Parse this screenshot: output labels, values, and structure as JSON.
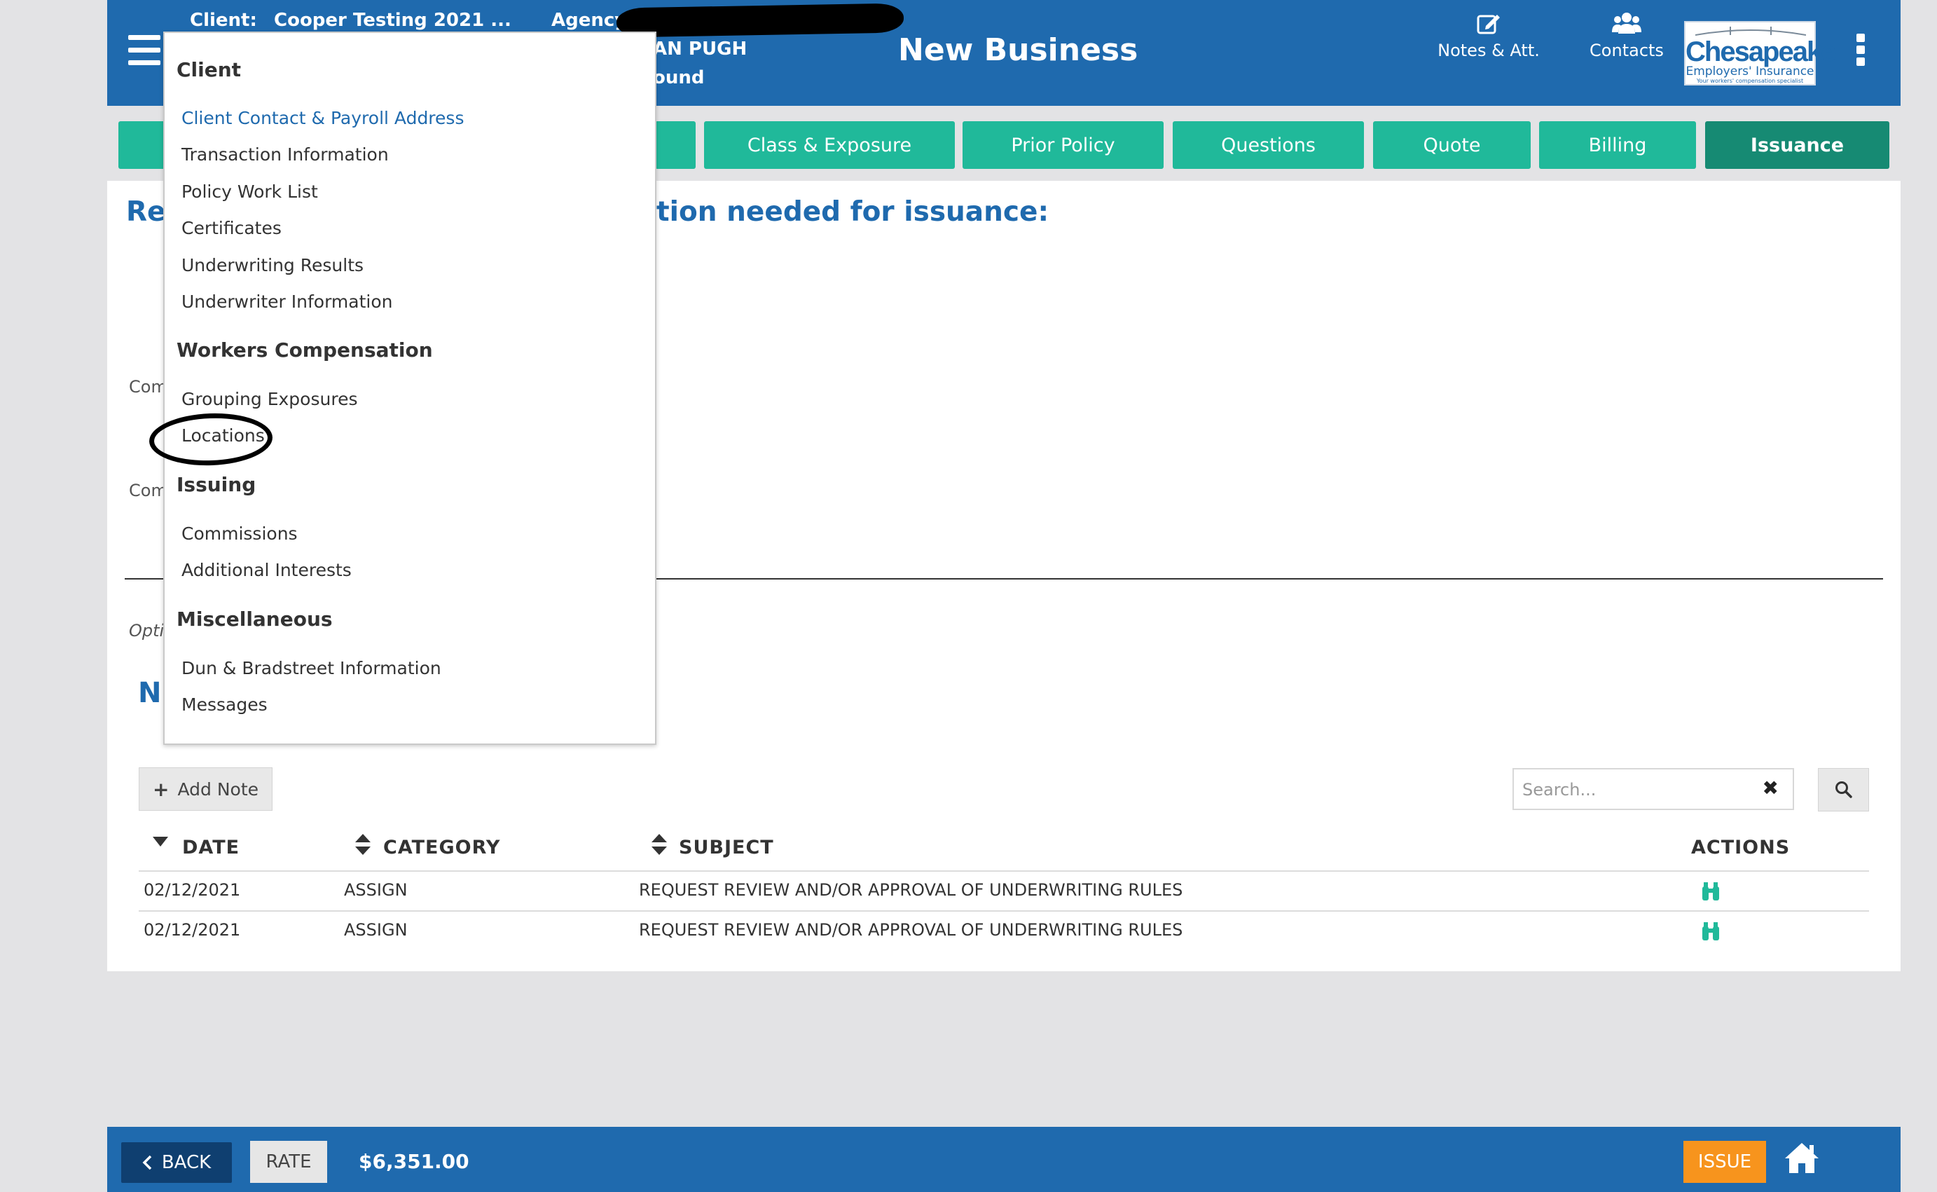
{
  "header": {
    "client_label": "Client:",
    "client_value": "Cooper Testing 2021 ...",
    "agency_label": "Agency:",
    "agency_partial": "AN PUGH",
    "agency_partial2": "ound",
    "page_title": "New Business",
    "notes_label": "Notes & Att.",
    "contacts_label": "Contacts",
    "logo_name": "Chesapeake",
    "logo_sub": "Employers' Insurance",
    "logo_tagline": "Your workers' compensation specialist"
  },
  "tabs": [
    {
      "label": ""
    },
    {
      "label": ""
    },
    {
      "label": "Class & Exposure"
    },
    {
      "label": "Prior Policy"
    },
    {
      "label": "Questions"
    },
    {
      "label": "Quote"
    },
    {
      "label": "Billing"
    },
    {
      "label": "Issuance"
    }
  ],
  "panel": {
    "heading_left": "Rev",
    "heading_right": "tion needed for issuance:",
    "frag_com1": "Com",
    "frag_com2": "Com",
    "frag_opt": "Opti",
    "frag_n": "N"
  },
  "menu": {
    "client_heading": "Client",
    "client_items": [
      "Client Contact & Payroll Address",
      "Transaction Information",
      "Policy Work List",
      "Certificates",
      "Underwriting Results",
      "Underwriter Information"
    ],
    "wc_heading": "Workers Compensation",
    "wc_items": [
      "Grouping Exposures",
      "Locations"
    ],
    "issuing_heading": "Issuing",
    "issuing_items": [
      "Commissions",
      "Additional Interests"
    ],
    "misc_heading": "Miscellaneous",
    "misc_items": [
      "Dun & Bradstreet Information",
      "Messages"
    ]
  },
  "notes": {
    "add_note_label": "Add Note",
    "search_placeholder": "Search...",
    "columns": [
      "DATE",
      "CATEGORY",
      "SUBJECT",
      "ACTIONS"
    ],
    "rows": [
      {
        "date": "02/12/2021",
        "category": "ASSIGN",
        "subject": "REQUEST REVIEW AND/OR APPROVAL OF UNDERWRITING RULES"
      },
      {
        "date": "02/12/2021",
        "category": "ASSIGN",
        "subject": "REQUEST REVIEW AND/OR APPROVAL OF UNDERWRITING RULES"
      }
    ]
  },
  "footer": {
    "back_label": "BACK",
    "rate_label": "RATE",
    "premium": "$6,351.00",
    "issue_label": "ISSUE"
  },
  "colors": {
    "header_blue": "#1f6aae",
    "tab_teal": "#20b99a",
    "tab_active": "#168a73",
    "issue_orange": "#f7941d"
  },
  "icons": [
    "menu-icon",
    "edit-icon",
    "contacts-icon",
    "kebab-icon",
    "plus-icon",
    "close-icon",
    "search-icon",
    "sort-icon",
    "binoculars-icon",
    "chevron-left-icon",
    "home-icon"
  ]
}
